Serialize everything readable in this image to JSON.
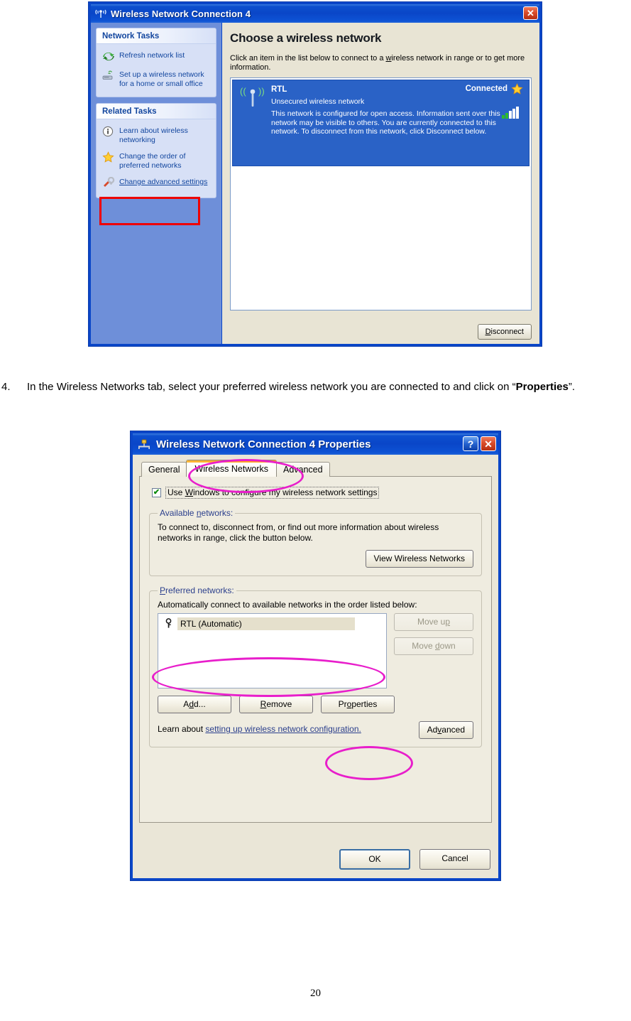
{
  "page": {
    "number": "20"
  },
  "figure1": {
    "title": "Wireless Network Connection 4",
    "title_icon": "wireless-signal-icon",
    "close_label": "✕",
    "sidebar": {
      "panels": [
        {
          "header": "Network Tasks",
          "items": [
            {
              "label": "Refresh network list",
              "icon": "refresh-icon",
              "link": false
            },
            {
              "label": "Set up a wireless network for a home or small office",
              "icon": "wireless-setup-icon",
              "link": false
            }
          ]
        },
        {
          "header": "Related Tasks",
          "items": [
            {
              "label": "Learn about wireless networking",
              "icon": "info-icon",
              "link": false
            },
            {
              "label": "Change the order of preferred networks",
              "icon": "star-icon",
              "link": false
            },
            {
              "label": "Change advanced settings",
              "icon": "tools-icon",
              "link": true
            }
          ]
        }
      ]
    },
    "main": {
      "heading": "Choose a wireless network",
      "instruction_pre": "Click an item in the list below to connect to a ",
      "instruction_underlined": "w",
      "instruction_post": "ireless network in range or to get more information.",
      "network": {
        "ssid": "RTL",
        "status": "Connected",
        "security": "Unsecured wireless network",
        "description": "This network is configured for open access. Information sent over this network may be visible to others. You are currently connected to this network. To disconnect from this network, click Disconnect below.",
        "icon": "wireless-antenna-icon",
        "status_icon": "star-icon",
        "signal_icon": "signal-strength-icon",
        "signal_bars": 5
      },
      "disconnect_accel": "D",
      "disconnect_rest": "isconnect"
    },
    "highlight_color": "#ee0000"
  },
  "step4": {
    "number": "4.",
    "text_before": "In the Wireless Networks tab, select your preferred wireless network you are connected to and click on “",
    "bold": "Properties",
    "text_after": "”."
  },
  "figure2": {
    "title": "Wireless Network Connection 4 Properties",
    "title_icon": "network-adapter-icon",
    "help_label": "?",
    "close_label": "✕",
    "tabs": [
      {
        "label": "General",
        "active": false
      },
      {
        "label": "Wireless Networks",
        "active": true
      },
      {
        "label": "Advanced",
        "active": false
      }
    ],
    "checkbox": {
      "checked": true,
      "check_glyph": "✔",
      "label_pre": "Use ",
      "label_accel": "W",
      "label_post": "indows to configure my wireless network settings"
    },
    "available_group": {
      "legend_pre": "Available ",
      "legend_accel": "n",
      "legend_post": "etworks:",
      "text": "To connect to, disconnect from, or find out more information about wireless networks in range, click the button below.",
      "button": "View Wireless Networks"
    },
    "preferred_group": {
      "legend_accel": "P",
      "legend_post": "referred networks:",
      "text": "Automatically connect to available networks in the order listed below:",
      "list_items": [
        {
          "label": "RTL (Automatic)",
          "icon": "wireless-key-icon",
          "selected": true
        }
      ],
      "move_up_pre": "Move u",
      "move_up_accel": "p",
      "move_down_pre": "Move ",
      "move_down_accel": "d",
      "move_down_post": "own",
      "add_pre": "A",
      "add_accel": "d",
      "add_post": "d...",
      "remove_accel": "R",
      "remove_post": "emove",
      "properties_pre": "Pr",
      "properties_accel": "o",
      "properties_post": "perties",
      "learn_pre": "Learn about ",
      "learn_link": "setting up wireless network configuration.",
      "advanced_pre": "Ad",
      "advanced_accel": "v",
      "advanced_post": "anced"
    },
    "ok_label": "OK",
    "cancel_label": "Cancel",
    "annotation_color": "#e81ecb"
  }
}
